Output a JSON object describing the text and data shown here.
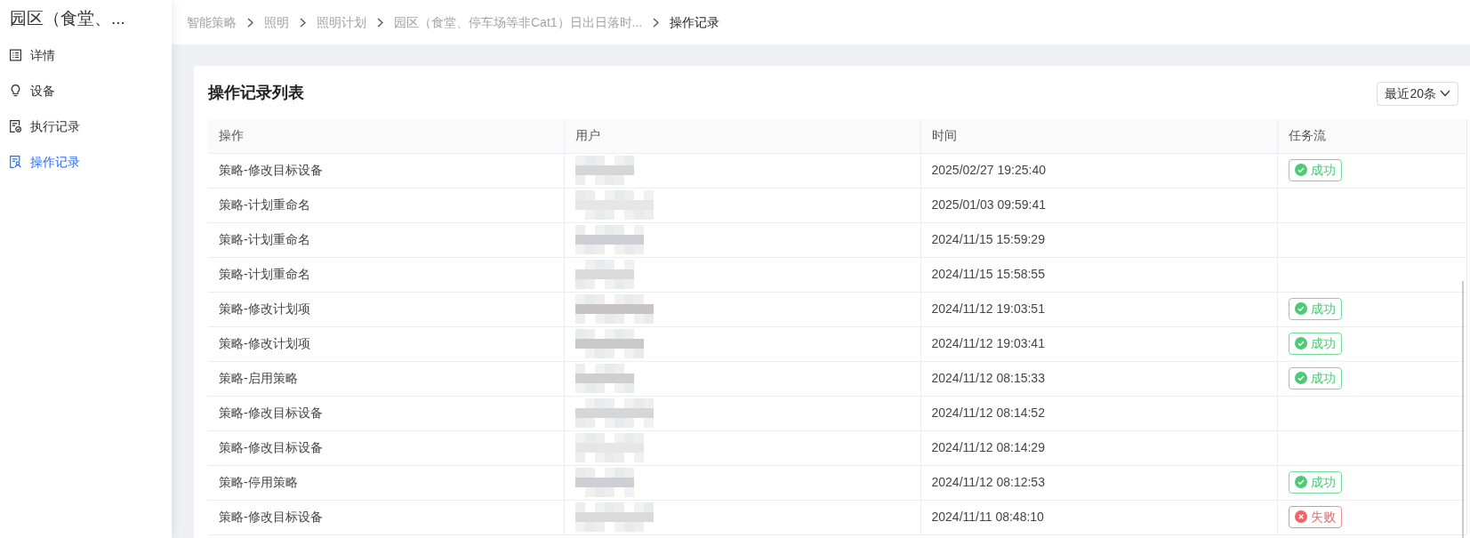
{
  "sidebar": {
    "title": "园区（食堂、...",
    "items": [
      {
        "label": "详情",
        "kind": "details",
        "selected": false
      },
      {
        "label": "设备",
        "kind": "device",
        "selected": false
      },
      {
        "label": "执行记录",
        "kind": "execution",
        "selected": false
      },
      {
        "label": "操作记录",
        "kind": "operation",
        "selected": true
      }
    ]
  },
  "breadcrumb": [
    {
      "label": "智能策略",
      "current": false
    },
    {
      "label": "照明",
      "current": false
    },
    {
      "label": "照明计划",
      "current": false
    },
    {
      "label": "园区（食堂、停车场等非Cat1）日出日落时...",
      "current": false
    },
    {
      "label": "操作记录",
      "current": true
    }
  ],
  "card": {
    "title": "操作记录列表",
    "filter": {
      "label": "最近20条"
    }
  },
  "table": {
    "columns": [
      "操作",
      "用户",
      "时间",
      "任务流"
    ],
    "rows": [
      {
        "operation": "策略-修改目标设备",
        "user_pixelated": true,
        "time": "2025/02/27 19:25:40",
        "status": {
          "kind": "success",
          "label": "成功"
        }
      },
      {
        "operation": "策略-计划重命名",
        "user_pixelated": true,
        "time": "2025/01/03 09:59:41"
      },
      {
        "operation": "策略-计划重命名",
        "user_pixelated": true,
        "time": "2024/11/15 15:59:29"
      },
      {
        "operation": "策略-计划重命名",
        "user_pixelated": true,
        "time": "2024/11/15 15:58:55"
      },
      {
        "operation": "策略-修改计划项",
        "user_pixelated": true,
        "time": "2024/11/12 19:03:51",
        "status": {
          "kind": "success",
          "label": "成功"
        }
      },
      {
        "operation": "策略-修改计划项",
        "user_pixelated": true,
        "time": "2024/11/12 19:03:41",
        "status": {
          "kind": "success",
          "label": "成功"
        }
      },
      {
        "operation": "策略-启用策略",
        "user_pixelated": true,
        "time": "2024/11/12 08:15:33",
        "status": {
          "kind": "success",
          "label": "成功"
        }
      },
      {
        "operation": "策略-修改目标设备",
        "user_pixelated": true,
        "time": "2024/11/12 08:14:52"
      },
      {
        "operation": "策略-修改目标设备",
        "user_pixelated": true,
        "time": "2024/11/12 08:14:29"
      },
      {
        "operation": "策略-停用策略",
        "user_pixelated": true,
        "time": "2024/11/12 08:12:53",
        "status": {
          "kind": "success",
          "label": "成功"
        }
      },
      {
        "operation": "策略-修改目标设备",
        "user_pixelated": true,
        "time": "2024/11/11 08:48:10",
        "status": {
          "kind": "failure",
          "label": "失败"
        }
      }
    ]
  }
}
